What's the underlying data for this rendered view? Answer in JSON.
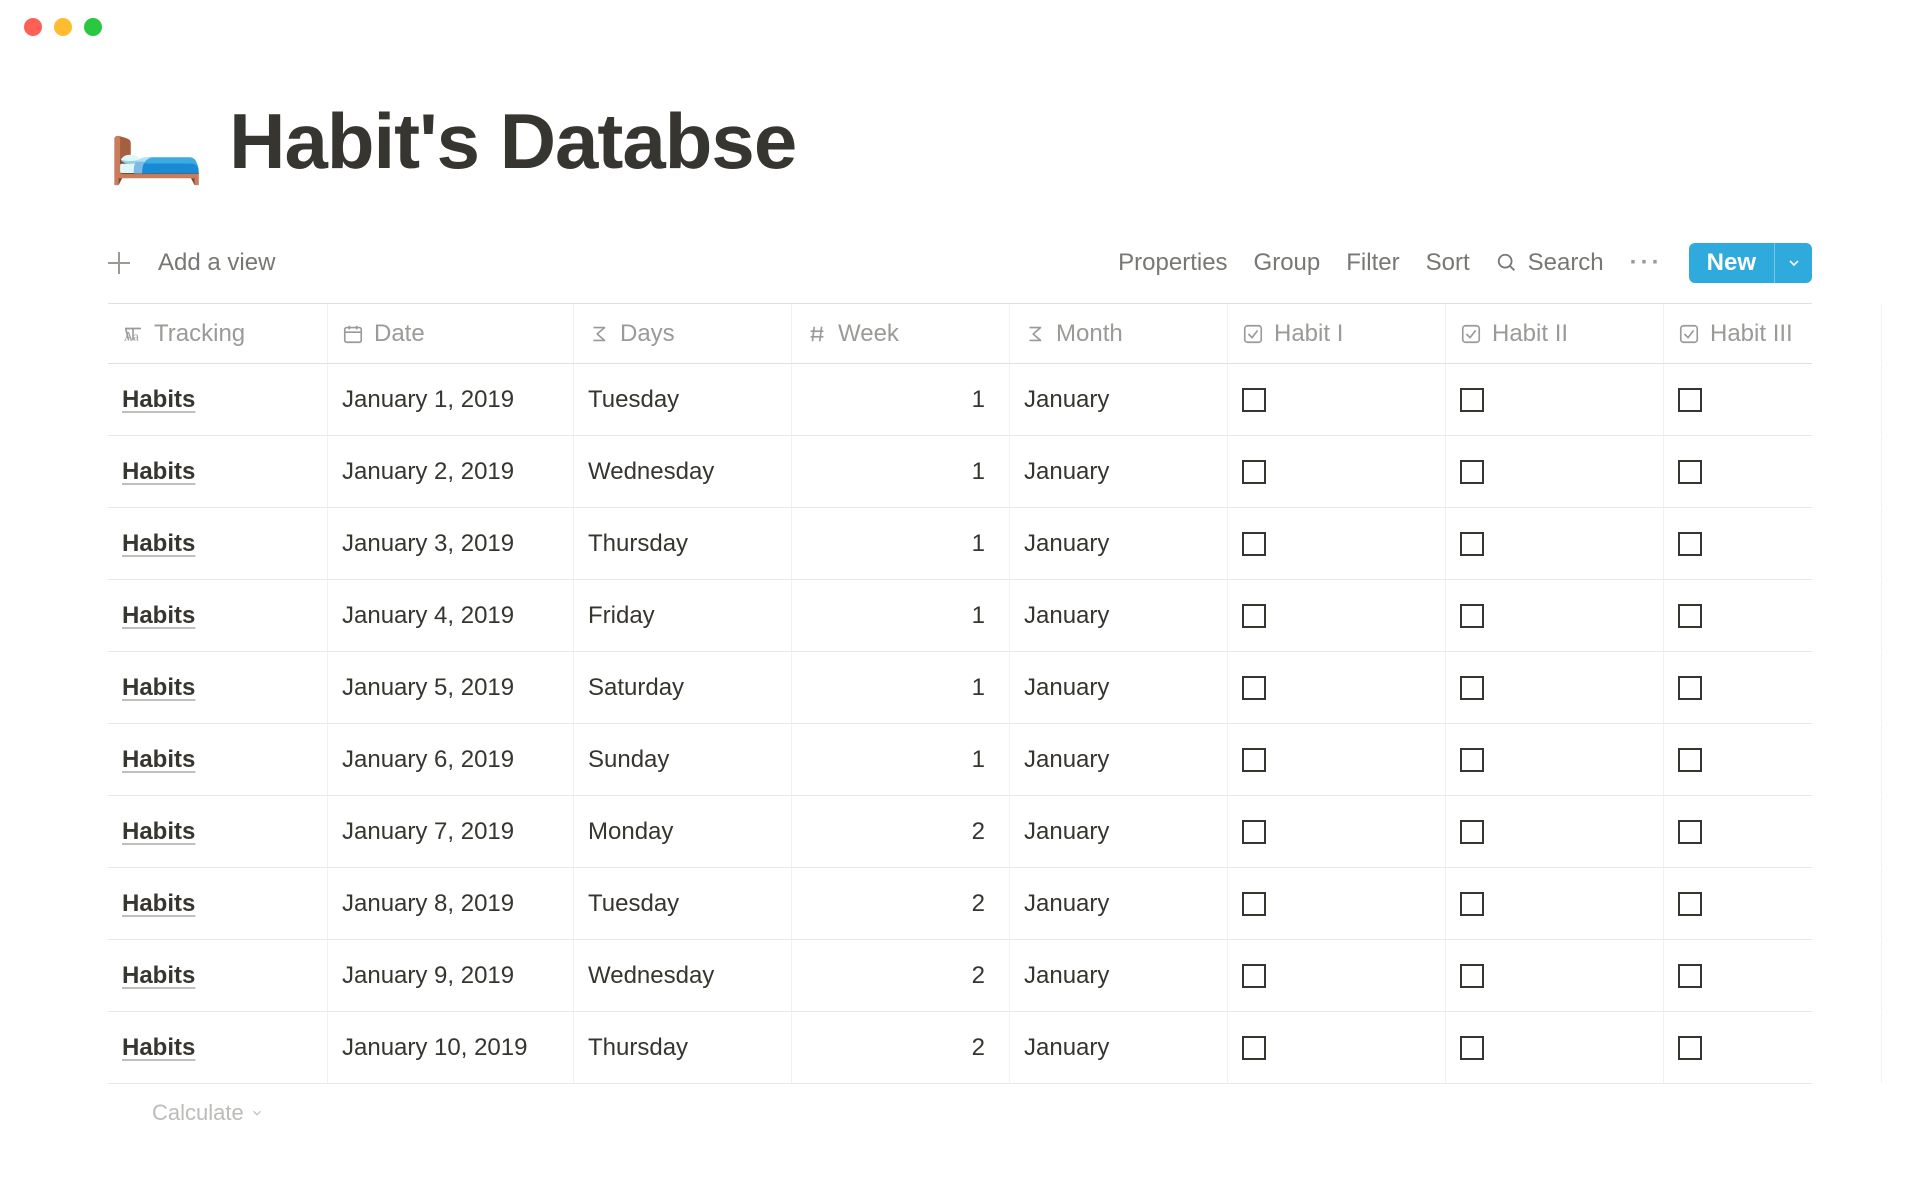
{
  "window": {
    "traffic_lights": true
  },
  "header": {
    "icon": "🛏️",
    "title": "Habit's Databse"
  },
  "toolbar": {
    "add_view": "Add a view",
    "properties": "Properties",
    "group": "Group",
    "filter": "Filter",
    "sort": "Sort",
    "search": "Search",
    "new_label": "New"
  },
  "columns": [
    {
      "key": "tracking",
      "label": "Tracking",
      "icon": "text"
    },
    {
      "key": "date",
      "label": "Date",
      "icon": "date"
    },
    {
      "key": "days",
      "label": "Days",
      "icon": "formula"
    },
    {
      "key": "week",
      "label": "Week",
      "icon": "number"
    },
    {
      "key": "month",
      "label": "Month",
      "icon": "formula"
    },
    {
      "key": "habit1",
      "label": "Habit I",
      "icon": "checkbox"
    },
    {
      "key": "habit2",
      "label": "Habit II",
      "icon": "checkbox"
    },
    {
      "key": "habit3",
      "label": "Habit III",
      "icon": "checkbox"
    }
  ],
  "rows": [
    {
      "tracking": "Habits",
      "date": "January 1, 2019",
      "days": "Tuesday",
      "week": "1",
      "month": "January",
      "habit1": false,
      "habit2": false,
      "habit3": false
    },
    {
      "tracking": "Habits",
      "date": "January 2, 2019",
      "days": "Wednesday",
      "week": "1",
      "month": "January",
      "habit1": false,
      "habit2": false,
      "habit3": false
    },
    {
      "tracking": "Habits",
      "date": "January 3, 2019",
      "days": "Thursday",
      "week": "1",
      "month": "January",
      "habit1": false,
      "habit2": false,
      "habit3": false
    },
    {
      "tracking": "Habits",
      "date": "January 4, 2019",
      "days": "Friday",
      "week": "1",
      "month": "January",
      "habit1": false,
      "habit2": false,
      "habit3": false
    },
    {
      "tracking": "Habits",
      "date": "January 5, 2019",
      "days": "Saturday",
      "week": "1",
      "month": "January",
      "habit1": false,
      "habit2": false,
      "habit3": false
    },
    {
      "tracking": "Habits",
      "date": "January 6, 2019",
      "days": "Sunday",
      "week": "1",
      "month": "January",
      "habit1": false,
      "habit2": false,
      "habit3": false
    },
    {
      "tracking": "Habits",
      "date": "January 7, 2019",
      "days": "Monday",
      "week": "2",
      "month": "January",
      "habit1": false,
      "habit2": false,
      "habit3": false
    },
    {
      "tracking": "Habits",
      "date": "January 8, 2019",
      "days": "Tuesday",
      "week": "2",
      "month": "January",
      "habit1": false,
      "habit2": false,
      "habit3": false
    },
    {
      "tracking": "Habits",
      "date": "January 9, 2019",
      "days": "Wednesday",
      "week": "2",
      "month": "January",
      "habit1": false,
      "habit2": false,
      "habit3": false
    },
    {
      "tracking": "Habits",
      "date": "January 10, 2019",
      "days": "Thursday",
      "week": "2",
      "month": "January",
      "habit1": false,
      "habit2": false,
      "habit3": false
    }
  ],
  "footer": {
    "calculate": "Calculate"
  }
}
